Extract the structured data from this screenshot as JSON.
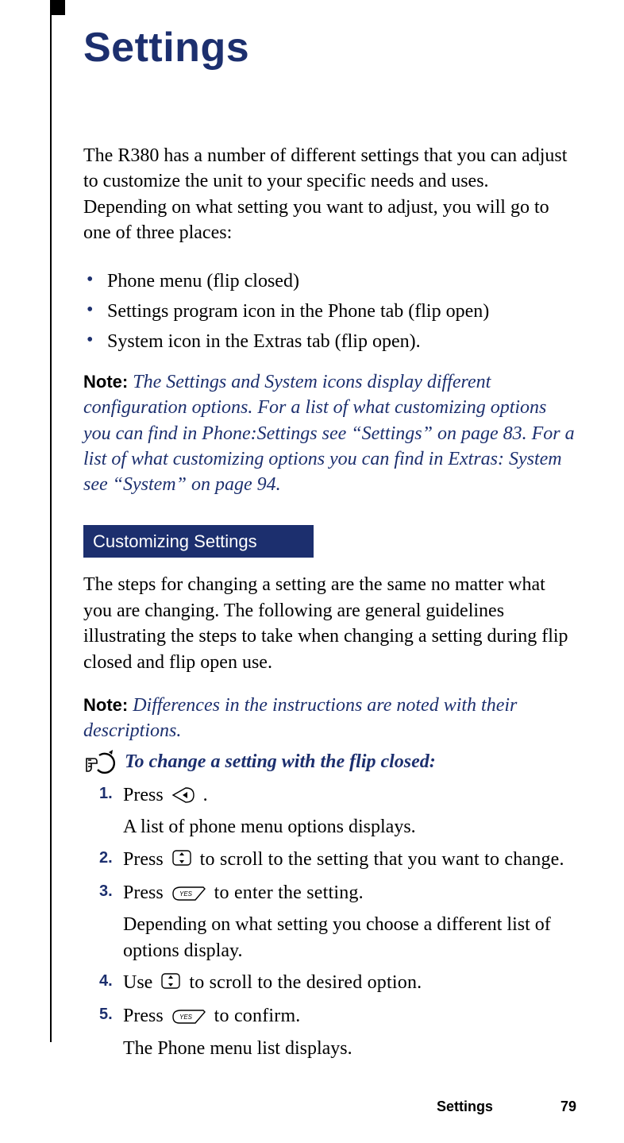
{
  "title": "Settings",
  "intro": "The R380 has a number of different settings that you can adjust to customize the unit to your specific needs and uses. Depending on what setting you want to adjust, you will go to one of three places:",
  "bullets": [
    "Phone menu (flip closed)",
    "Settings program icon in the Phone tab (flip open)",
    "System icon in the Extras tab (flip open)."
  ],
  "note1": {
    "label": "Note:",
    "text": "The Settings and System icons display different configuration options. For a list of what customizing options you can find in Phone:Settings see “Settings” on page 83. For a list of what customizing options you can find in Extras: System see “System” on page 94."
  },
  "section_bar": "Customizing Settings",
  "section_intro": "The steps for changing a setting are the same no matter what you are changing. The following are general guidelines illustrating the steps to take when changing a setting during flip closed and flip open use.",
  "note2": {
    "label": "Note:",
    "text": "Differences in the instructions are noted with their descriptions."
  },
  "subhead": "To change a setting with the flip closed:",
  "steps": {
    "s1_pre": "Press ",
    "s1_post": ".",
    "s1_sub": "A list of phone menu options displays.",
    "s2_pre": "Press ",
    "s2_post": " to scroll to the setting that you want to change.",
    "s3_pre": "Press ",
    "s3_post": " to enter the setting.",
    "s3_sub": "Depending on what setting you choose a different list of options display.",
    "s4_pre": "Use ",
    "s4_post": " to scroll to the desired option.",
    "s5_pre": "Press  ",
    "s5_post": " to confirm.",
    "s5_sub": "The Phone menu list displays."
  },
  "footer": {
    "section": "Settings",
    "page": "79"
  }
}
